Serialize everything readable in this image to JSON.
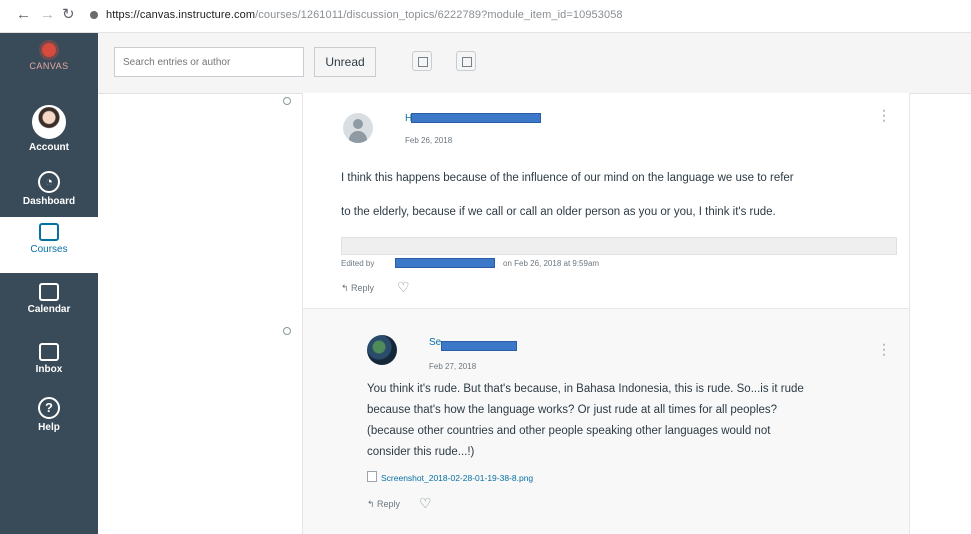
{
  "browser": {
    "url_host": "https://canvas.instructure.com",
    "url_path": "/courses/1261011/discussion_topics/6222789?module_item_id=10953058"
  },
  "global_nav": {
    "logo_label": "CANVAS",
    "items": [
      {
        "label": "Account"
      },
      {
        "label": "Dashboard"
      },
      {
        "label": "Courses"
      },
      {
        "label": "Calendar"
      },
      {
        "label": "Inbox"
      },
      {
        "label": "Help"
      }
    ]
  },
  "toolbar": {
    "search_placeholder": "Search entries or author",
    "unread_label": "Unread"
  },
  "entries": [
    {
      "author_initial": "H",
      "date": "Feb 26, 2018",
      "body_lines": [
        "I think this happens because of the influence of our mind on the language we use to refer",
        "to the elderly, because if we call or call an older person as you or you, I think it's rude."
      ],
      "edited_prefix": "Edited by",
      "edited_suffix": "on Feb 26, 2018 at 9:59am",
      "reply_label": "Reply"
    },
    {
      "author_initial": "Se",
      "date": "Feb 27, 2018",
      "body_lines": [
        "You think it's rude. But that's because, in Bahasa Indonesia, this is rude. So...is it rude",
        "because that's how the language works? Or just rude at all times for all peoples?",
        "(because other countries and other people speaking other languages would not",
        "consider this rude...!)"
      ],
      "attachment": "Screenshot_2018-02-28-01-19-38-8.png",
      "reply_label": "Reply"
    }
  ],
  "colors": {
    "nav_bg": "#394b58",
    "link": "#0770a3",
    "redaction": "#3c78c8"
  }
}
